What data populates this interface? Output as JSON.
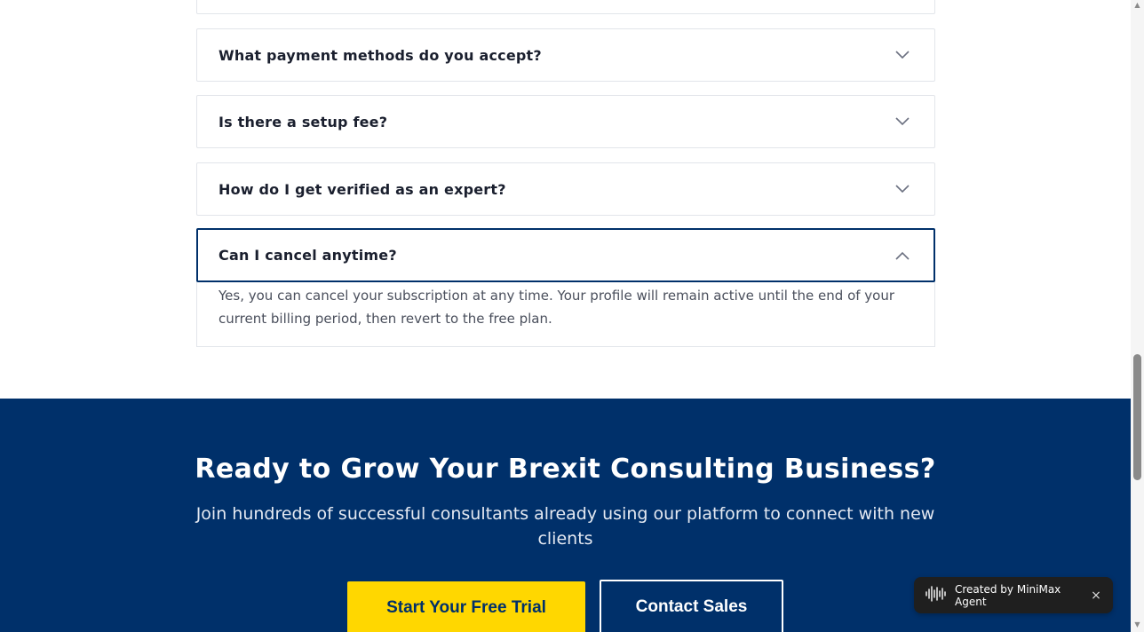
{
  "faq": {
    "items": [
      {
        "question": "What payment methods do you accept?",
        "open": false
      },
      {
        "question": "Is there a setup fee?",
        "open": false
      },
      {
        "question": "How do I get verified as an expert?",
        "open": false
      },
      {
        "question": "Can I cancel anytime?",
        "open": true,
        "answer": "Yes, you can cancel your subscription at any time. Your profile will remain active until the end of your current billing period, then revert to the free plan."
      }
    ]
  },
  "cta": {
    "title": "Ready to Grow Your Brexit Consulting Business?",
    "subtitle": "Join hundreds of successful consultants already using our platform to connect with new clients",
    "primary_button": "Start Your Free Trial",
    "secondary_button": "Contact Sales"
  },
  "badge": {
    "label": "Created by MiniMax Agent",
    "icon": "waveform-icon",
    "close": "×"
  },
  "colors": {
    "brand_navy": "#00306a",
    "accent_yellow": "#ffd700",
    "text_dark": "#1a1f2e"
  }
}
